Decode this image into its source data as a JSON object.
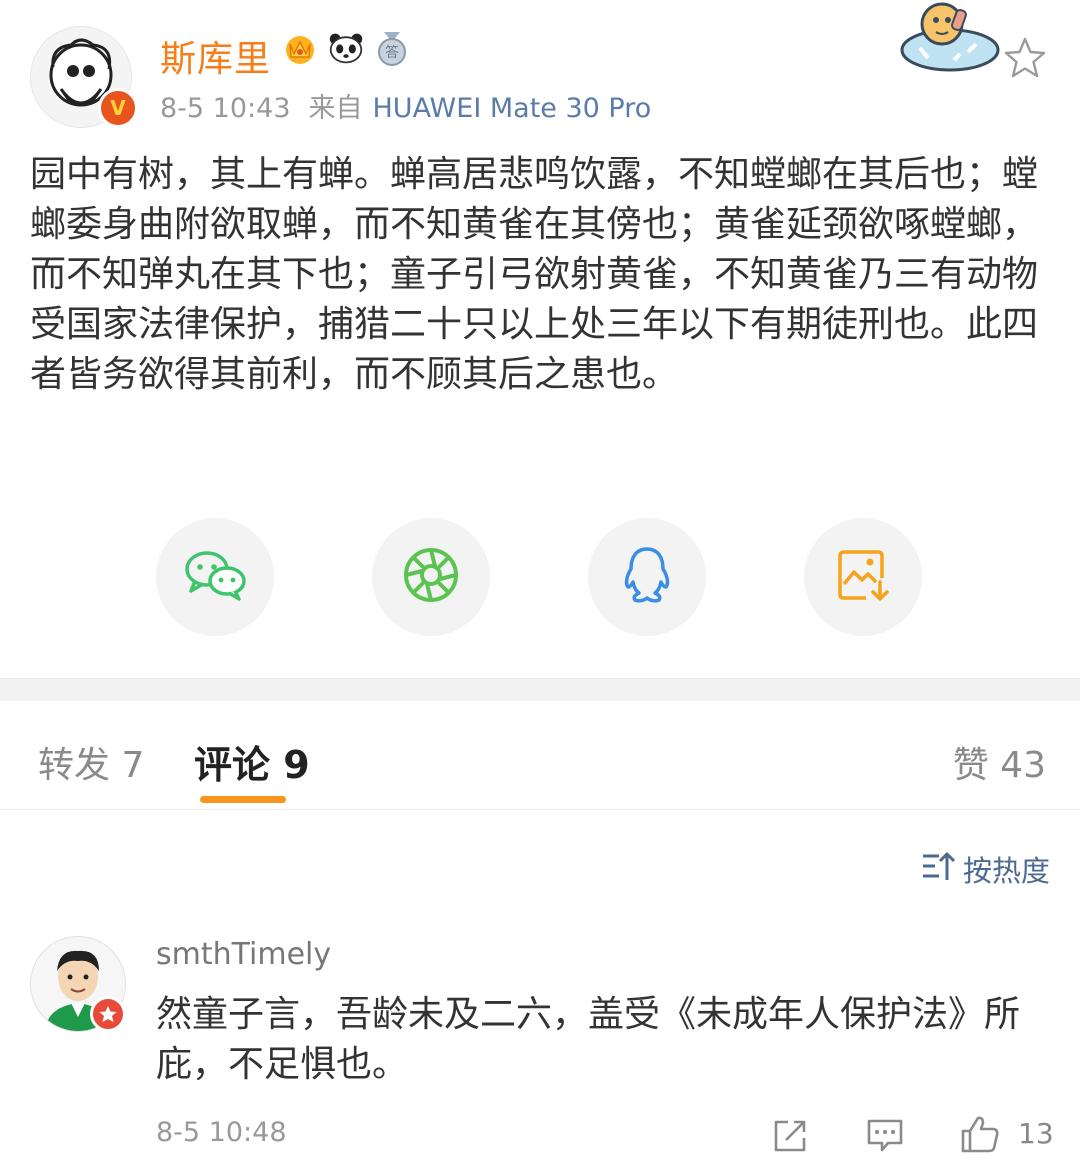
{
  "post": {
    "author": "斯库里",
    "time": "8-5 10:43",
    "source_prefix": "来自",
    "source": "HUAWEI Mate 30 Pro",
    "verify_mark": "V",
    "badge_medal_text": "答",
    "body": "园中有树，其上有蝉。蝉高居悲鸣饮露，不知螳螂在其后也；螳螂委身曲附欲取蝉，而不知黄雀在其傍也；黄雀延颈欲啄螳螂，而不知弹丸在其下也；童子引弓欲射黄雀，不知黄雀乃三有动物受国家法律保护，捕猎二十只以上处三年以下有期徒刑也。此四者皆务欲得其前利，而不顾其后之患也。"
  },
  "share": {
    "icons": [
      "wechat-icon",
      "moments-icon",
      "qq-icon",
      "save-image-icon"
    ],
    "colors": {
      "wechat": "#3ec46d",
      "moments": "#5bc450",
      "qq": "#3a8ee6",
      "save": "#f7a21b"
    }
  },
  "tabs": {
    "repost": "转发 7",
    "comments": "评论 9",
    "likes": "赞 43"
  },
  "sort": {
    "label": "按热度"
  },
  "comments": [
    {
      "user": "smthTimely",
      "text": "然童子言，吾龄未及二六，盖受《未成年人保护法》所庇，不足惧也。",
      "time": "8-5 10:48",
      "likes": "13"
    }
  ],
  "colors": {
    "accent": "#f7941d",
    "username": "#f77e17",
    "link": "#5b7ca8"
  }
}
